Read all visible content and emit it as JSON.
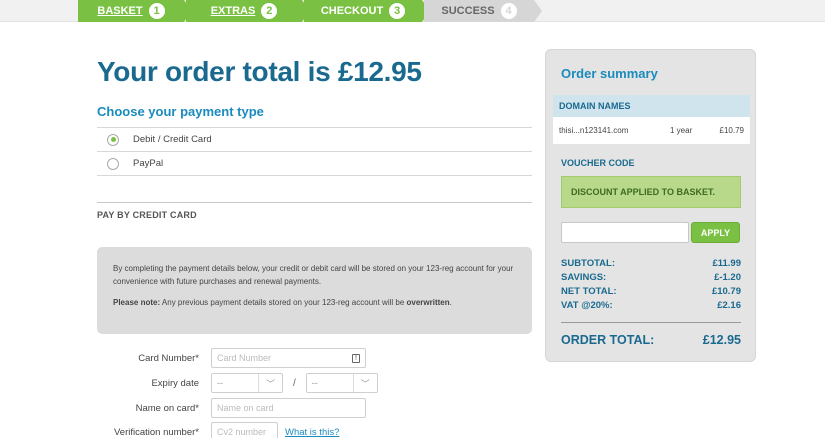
{
  "progress": {
    "steps": [
      {
        "label": "BASKET",
        "num": "1"
      },
      {
        "label": "EXTRAS",
        "num": "2"
      },
      {
        "label": "CHECKOUT",
        "num": "3"
      },
      {
        "label": "SUCCESS",
        "num": "4"
      }
    ]
  },
  "main": {
    "title": "Your order total is £12.95",
    "payment_heading": "Choose your payment type",
    "payment_options": [
      {
        "label": "Debit / Credit Card",
        "selected": true
      },
      {
        "label": "PayPal",
        "selected": false
      }
    ],
    "pay_by_card": "PAY BY CREDIT CARD",
    "info_text": "By completing the payment details below, your credit or debit card will be stored on your 123-reg account for your convenience with future purchases and renewal payments.",
    "note_label": "Please note:",
    "note_text": " Any previous payment details stored on your 123-reg account will be ",
    "note_strong": "overwritten",
    "note_end": "."
  },
  "form": {
    "card_number_label": "Card Number*",
    "card_number_placeholder": "Card Number",
    "expiry_label": "Expiry date",
    "expiry_month": "--",
    "expiry_year": "--",
    "expiry_sep": "/",
    "name_label": "Name on card*",
    "name_placeholder": "Name on card",
    "cv2_label": "Verification number*",
    "cv2_placeholder": "Cv2 number",
    "help_link": "What is this?"
  },
  "summary": {
    "title": "Order summary",
    "domain_heading": "DOMAIN NAMES",
    "domain_name": "thisi...n123141.com",
    "domain_term": "1 year",
    "domain_price": "£10.79",
    "voucher_heading": "VOUCHER CODE",
    "voucher_message": "DISCOUNT APPLIED TO BASKET.",
    "apply_label": "APPLY",
    "subtotal_label": "SUBTOTAL:",
    "subtotal": "£11.99",
    "savings_label": "SAVINGS:",
    "savings": "£-1.20",
    "net_label": "NET TOTAL:",
    "net": "£10.79",
    "vat_label": "VAT @20%:",
    "vat": "£2.16",
    "order_total_label": "ORDER TOTAL:",
    "order_total": "£12.95"
  },
  "colors": {
    "accent_green": "#7ac143",
    "title_blue": "#1a6a8f",
    "link_blue": "#1a8bbd"
  }
}
